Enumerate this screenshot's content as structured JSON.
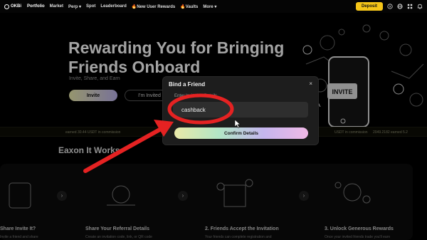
{
  "nav": {
    "logo": "OKBi",
    "items": [
      "Portfolio",
      "Market",
      "Perp ▾",
      "Spot",
      "Leaderboard",
      "🔥New User Rewards",
      "🔥Vaults",
      "More ▾"
    ],
    "deposit": "Deposit",
    "icons": [
      "help-icon",
      "globe-icon",
      "grid-icon",
      "bell-icon"
    ]
  },
  "hero": {
    "title": "Rewarding You for Bringing Friends Onboard",
    "subtitle": "Invite, Share, and Earn",
    "invite_btn": "Invite",
    "invited_btn": "I'm Invited"
  },
  "illustration": {
    "badge": "INVITE"
  },
  "ticker": [
    "earned 30.44 USDT in commission",
    "USDT in commission",
    "2049.2182 earned 5.2"
  ],
  "how": {
    "title": "Eaxon It Works",
    "steps": [
      {
        "title": "Share Invite It?",
        "desc": "Invite a friend and share"
      },
      {
        "title": "Share Your Referral Details",
        "desc": "Create an invitation code, link, or QR code"
      },
      {
        "title": "2. Friends Accept the Invitation",
        "desc": "Your friends can complete registration and"
      },
      {
        "title": "3. Unlock Generous Rewards",
        "desc": "Once your invited friends trade you'll earn"
      }
    ]
  },
  "modal": {
    "title": "Bind a Friend",
    "label": "Enter Invitation Details",
    "input_value": "cashback",
    "confirm": "Confirm Details",
    "close": "×"
  },
  "colors": {
    "accent": "#f5c518",
    "annotation": "#e52222"
  }
}
